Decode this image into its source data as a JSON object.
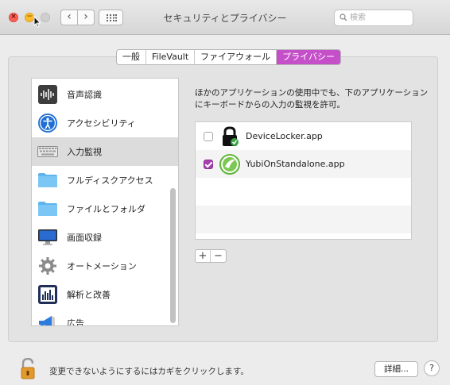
{
  "window": {
    "title": "セキュリティとプライバシー",
    "search_placeholder": "検索"
  },
  "tabs": [
    {
      "label": "一般",
      "active": false
    },
    {
      "label": "FileVault",
      "active": false
    },
    {
      "label": "ファイアウォール",
      "active": false
    },
    {
      "label": "プライバシー",
      "active": true
    }
  ],
  "sidebar": {
    "items": [
      {
        "label": "音声認識",
        "icon": "speech-recognition-icon"
      },
      {
        "label": "アクセシビリティ",
        "icon": "accessibility-icon"
      },
      {
        "label": "入力監視",
        "icon": "keyboard-icon",
        "selected": true
      },
      {
        "label": "フルディスクアクセス",
        "icon": "folder-icon"
      },
      {
        "label": "ファイルとフォルダ",
        "icon": "folder-icon"
      },
      {
        "label": "画面収録",
        "icon": "display-icon"
      },
      {
        "label": "オートメーション",
        "icon": "gear-icon"
      },
      {
        "label": "解析と改善",
        "icon": "analytics-icon"
      },
      {
        "label": "広告",
        "icon": "megaphone-icon"
      }
    ]
  },
  "main": {
    "description": "ほかのアプリケーションの使用中でも、下のアプリケーションにキーボードからの入力の監視を許可。",
    "apps": [
      {
        "name": "DeviceLocker.app",
        "checked": false,
        "icon": "lock-icon"
      },
      {
        "name": "YubiOnStandalone.app",
        "checked": true,
        "icon": "yubi-icon"
      }
    ],
    "add_label": "+",
    "remove_label": "−"
  },
  "footer": {
    "lock_message": "変更できないようにするにはカギをクリックします。",
    "detail_button": "詳細...",
    "help_button": "?"
  },
  "colors": {
    "accent": "#c54fc9",
    "checkbox_checked": "#a73fb0"
  }
}
